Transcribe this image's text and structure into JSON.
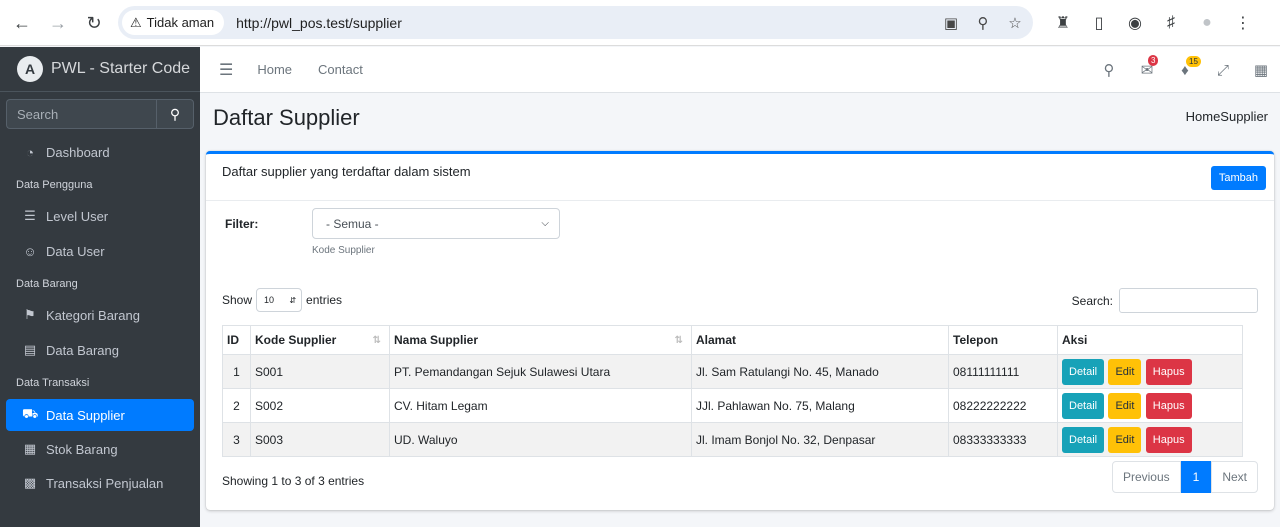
{
  "browser": {
    "security_label": "Tidak aman",
    "url": "http://pwl_pos.test/supplier"
  },
  "brand": {
    "logo_letter": "A",
    "name": "PWL - Starter Code"
  },
  "sidebar": {
    "search_placeholder": "Search",
    "items": {
      "dashboard": "Dashboard",
      "level_user": "Level User",
      "data_user": "Data User",
      "kategori_barang": "Kategori Barang",
      "data_barang": "Data Barang",
      "data_supplier": "Data Supplier",
      "stok_barang": "Stok Barang",
      "transaksi_penjualan": "Transaksi Penjualan"
    },
    "headers": {
      "pengguna": "Data Pengguna",
      "barang": "Data Barang",
      "transaksi": "Data Transaksi"
    }
  },
  "topnav": {
    "home": "Home",
    "contact": "Contact",
    "messages_badge": "3",
    "notifications_badge": "15"
  },
  "page": {
    "title": "Daftar Supplier",
    "breadcrumb": "HomeSupplier"
  },
  "card": {
    "title": "Daftar supplier yang terdaftar dalam sistem",
    "add_button": "Tambah",
    "filter_label": "Filter:",
    "filter_selected": "- Semua -",
    "filter_help": "Kode Supplier",
    "show_label": "Show",
    "page_length": "10",
    "entries_label": "entries",
    "search_label": "Search:",
    "info": "Showing 1 to 3 of 3 entries",
    "pagination": {
      "previous": "Previous",
      "current": "1",
      "next": "Next"
    }
  },
  "table": {
    "headers": [
      "ID",
      "Kode Supplier",
      "Nama Supplier",
      "Alamat",
      "Telepon",
      "Aksi"
    ],
    "rows": [
      {
        "no": "1",
        "kode": "S001",
        "nama": "PT. Pemandangan Sejuk Sulawesi Utara",
        "alamat": "Jl. Sam Ratulangi No. 45, Manado",
        "telepon": "08111111111"
      },
      {
        "no": "2",
        "kode": "S002",
        "nama": "CV. Hitam Legam",
        "alamat": "JJl. Pahlawan No. 75, Malang",
        "telepon": "08222222222"
      },
      {
        "no": "3",
        "kode": "S003",
        "nama": "UD. Waluyo",
        "alamat": "Jl. Imam Bonjol No. 32, Denpasar",
        "telepon": "08333333333"
      }
    ],
    "actions": {
      "detail": "Detail",
      "edit": "Edit",
      "hapus": "Hapus"
    }
  },
  "colors": {
    "primary": "#007bff",
    "sidebar_bg": "#343a40",
    "info": "#17a2b8",
    "warning": "#ffc107",
    "danger": "#dc3545"
  }
}
